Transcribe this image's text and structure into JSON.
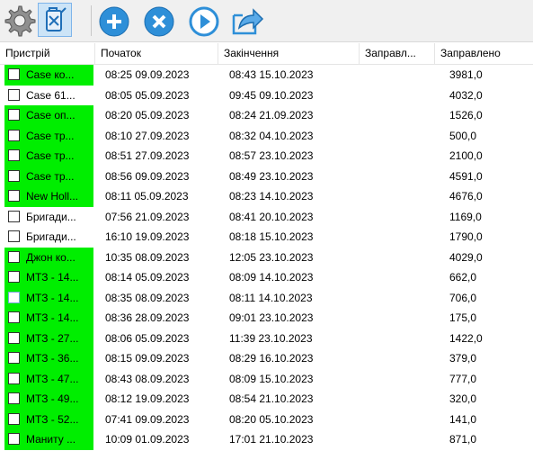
{
  "toolbar": {
    "buttons": [
      {
        "name": "settings",
        "icon": "gear-icon"
      },
      {
        "name": "fuel-canister",
        "icon": "fuel-canister-icon",
        "active": true
      },
      {
        "name": "add",
        "icon": "plus-circle-icon"
      },
      {
        "name": "delete",
        "icon": "x-circle-icon"
      },
      {
        "name": "play",
        "icon": "play-circle-icon"
      },
      {
        "name": "export",
        "icon": "export-arrow-icon"
      }
    ]
  },
  "table": {
    "columns": [
      "Пристрій",
      "Початок",
      "Закінчення",
      "Заправл...",
      "Заправлено"
    ],
    "rows": [
      {
        "device": "Case  ко...",
        "start": "08:25 09.09.2023",
        "end": "08:43 15.10.2023",
        "filled": "",
        "amount": "3981,0",
        "green": true
      },
      {
        "device": "Case 61...",
        "start": "08:05 05.09.2023",
        "end": "09:45 09.10.2023",
        "filled": "",
        "amount": "4032,0",
        "green": false
      },
      {
        "device": "Case оп...",
        "start": "08:20 05.09.2023",
        "end": "08:24 21.09.2023",
        "filled": "",
        "amount": "1526,0",
        "green": true
      },
      {
        "device": "Case тр...",
        "start": "08:10 27.09.2023",
        "end": "08:32 04.10.2023",
        "filled": "",
        "amount": "500,0",
        "green": true
      },
      {
        "device": "Case тр...",
        "start": "08:51 27.09.2023",
        "end": "08:57 23.10.2023",
        "filled": "",
        "amount": "2100,0",
        "green": true
      },
      {
        "device": "Case тр...",
        "start": "08:56 09.09.2023",
        "end": "08:49 23.10.2023",
        "filled": "",
        "amount": "4591,0",
        "green": true
      },
      {
        "device": "New Holl...",
        "start": "08:11 05.09.2023",
        "end": "08:23 14.10.2023",
        "filled": "",
        "amount": "4676,0",
        "green": true
      },
      {
        "device": "Бригади...",
        "start": "07:56 21.09.2023",
        "end": "08:41 20.10.2023",
        "filled": "",
        "amount": "1169,0",
        "green": false
      },
      {
        "device": "Бригади...",
        "start": "16:10 19.09.2023",
        "end": "08:18 15.10.2023",
        "filled": "",
        "amount": "1790,0",
        "green": false
      },
      {
        "device": "Джон ко...",
        "start": "10:35 08.09.2023",
        "end": "12:05 23.10.2023",
        "filled": "",
        "amount": "4029,0",
        "green": true
      },
      {
        "device": "МТЗ - 14...",
        "start": "08:14 05.09.2023",
        "end": "08:09 14.10.2023",
        "filled": "",
        "amount": "662,0",
        "green": true
      },
      {
        "device": "МТЗ - 14...",
        "start": "08:35 08.09.2023",
        "end": "08:11 14.10.2023",
        "filled": "",
        "amount": "706,0",
        "green": true
      },
      {
        "device": "МТЗ - 14...",
        "start": "08:36 28.09.2023",
        "end": "09:01 23.10.2023",
        "filled": "",
        "amount": "175,0",
        "green": true
      },
      {
        "device": "МТЗ - 27...",
        "start": "08:06 05.09.2023",
        "end": "11:39 23.10.2023",
        "filled": "",
        "amount": "1422,0",
        "green": true
      },
      {
        "device": "МТЗ - 36...",
        "start": "08:15 09.09.2023",
        "end": "08:29 16.10.2023",
        "filled": "",
        "amount": "379,0",
        "green": true
      },
      {
        "device": "МТЗ - 47...",
        "start": "08:43 08.09.2023",
        "end": "08:09 15.10.2023",
        "filled": "",
        "amount": "777,0",
        "green": true
      },
      {
        "device": "МТЗ - 49...",
        "start": "08:12 19.09.2023",
        "end": "08:54 21.10.2023",
        "filled": "",
        "amount": "320,0",
        "green": true
      },
      {
        "device": "МТЗ - 52...",
        "start": "07:41 09.09.2023",
        "end": "08:20 05.10.2023",
        "filled": "",
        "amount": "141,0",
        "green": true
      },
      {
        "device": "Маниту ...",
        "start": "10:09 01.09.2023",
        "end": "17:01 21.10.2023",
        "filled": "",
        "amount": "871,0",
        "green": true
      }
    ]
  },
  "colors": {
    "row_highlight": "#00ee00",
    "toolbar_bg": "#f0f0f0",
    "icon_blue": "#2e8fd8"
  }
}
